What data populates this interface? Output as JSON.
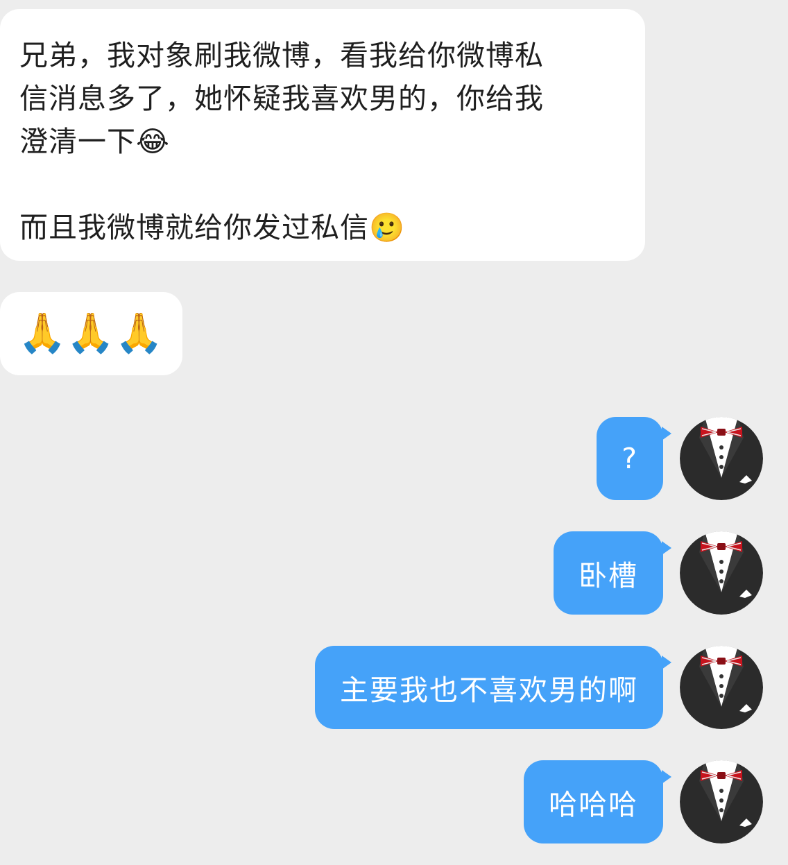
{
  "chat": {
    "incoming": [
      {
        "text": "兄弟，我对象刷我微博，看我给你微博私\n信消息多了，她怀疑我喜欢男的，你给我\n澄清一下😂\n\n而且我微博就给你发过私信🥲"
      },
      {
        "text": "🙏🙏🙏"
      }
    ],
    "outgoing": [
      {
        "text": "?"
      },
      {
        "text": "卧槽"
      },
      {
        "text": "主要我也不喜欢男的啊"
      },
      {
        "text": "哈哈哈"
      }
    ]
  },
  "colors": {
    "background": "#ededed",
    "incoming_bubble": "#ffffff",
    "outgoing_bubble": "#45a2f9",
    "incoming_text": "#1f1f1f",
    "outgoing_text": "#ffffff"
  },
  "icons": {
    "avatar": "tuxedo-bowtie-avatar"
  }
}
